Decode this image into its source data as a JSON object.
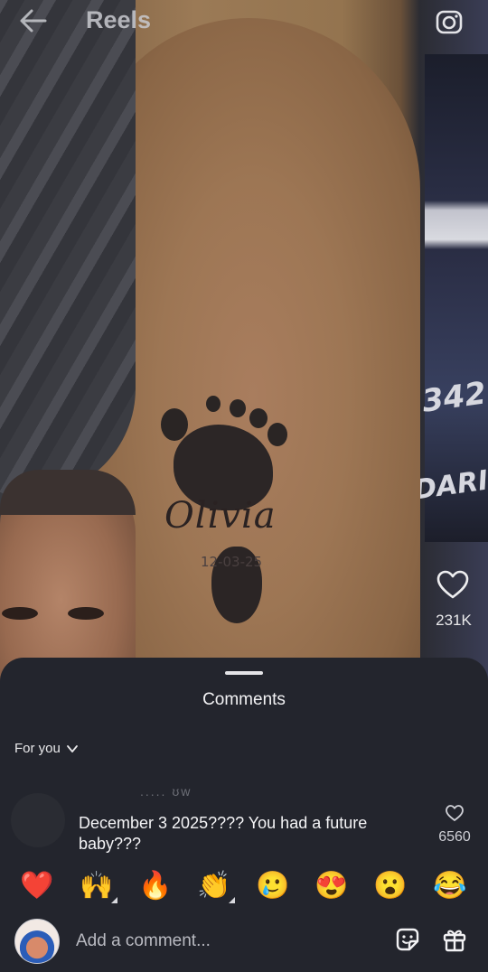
{
  "header": {
    "title": "Reels",
    "back_icon": "back-arrow-icon",
    "camera_icon": "camera-icon"
  },
  "reel": {
    "tattoo_name": "Olivia",
    "tattoo_date": "12-03-25",
    "banner_text_1": "342",
    "banner_text_2": "DARI",
    "likes": "231K"
  },
  "comments_sheet": {
    "title": "Comments",
    "filter": "For you",
    "comments": [
      {
        "header": "..... ʊw",
        "text": "December 3 2025???? You had a future baby???",
        "likes": "6560"
      }
    ]
  },
  "reactions": [
    "❤️",
    "🙌",
    "🔥",
    "👏",
    "🥲",
    "😍",
    "😮",
    "😂"
  ],
  "composer": {
    "placeholder": "Add a comment...",
    "sticker_icon": "sticker-icon",
    "gift_icon": "gift-icon"
  },
  "colors": {
    "sheet_bg": "#23252d",
    "heart_red": "#f0364f"
  }
}
